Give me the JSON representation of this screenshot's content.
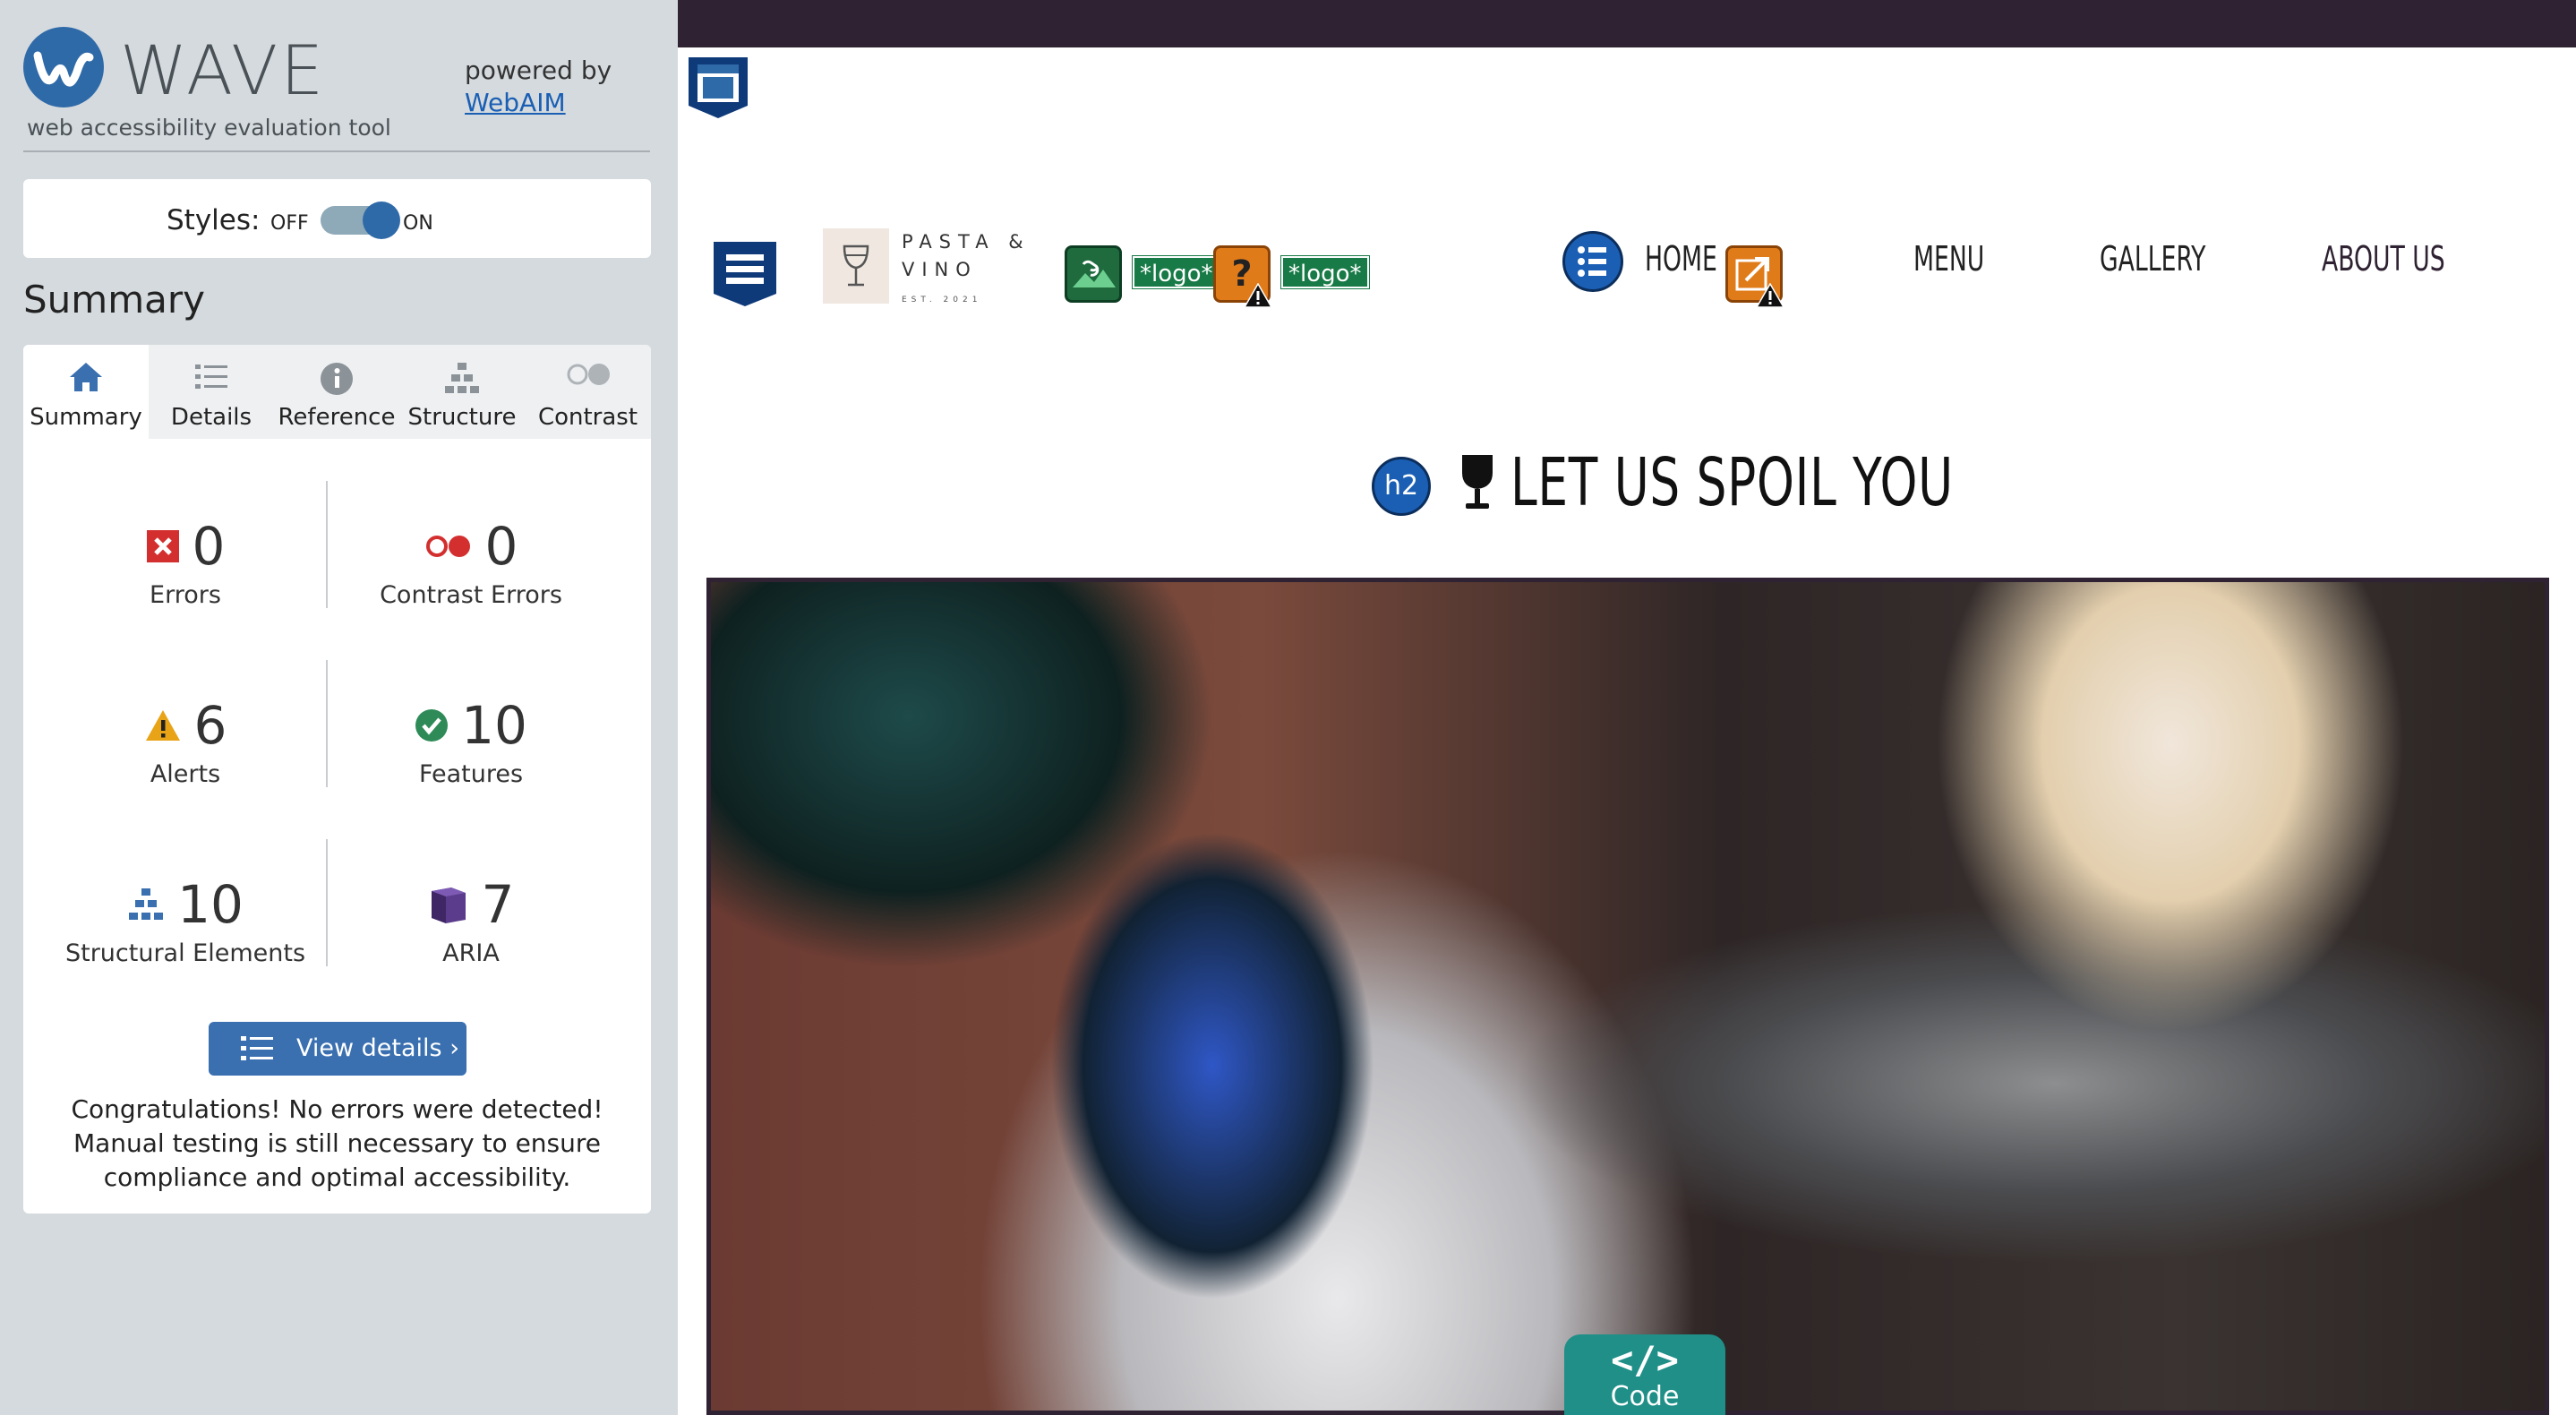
{
  "wave": {
    "title": "WAVE",
    "subtitle": "web accessibility evaluation tool",
    "powered_by": "powered by",
    "webaim_link": "WebAIM",
    "styles": {
      "label": "Styles:",
      "off": "OFF",
      "on": "ON",
      "state": "on"
    },
    "summary_heading": "Summary",
    "tabs": [
      {
        "label": "Summary",
        "icon": "home-icon",
        "active": true
      },
      {
        "label": "Details",
        "icon": "list-icon",
        "active": false
      },
      {
        "label": "Reference",
        "icon": "info-icon",
        "active": false
      },
      {
        "label": "Structure",
        "icon": "hierarchy-icon",
        "active": false
      },
      {
        "label": "Contrast",
        "icon": "contrast-icon",
        "active": false
      }
    ],
    "stats": {
      "errors": {
        "count": "0",
        "label": "Errors",
        "color": "#d32f2f"
      },
      "contrast_errors": {
        "count": "0",
        "label": "Contrast Errors",
        "color": "#d32f2f"
      },
      "alerts": {
        "count": "6",
        "label": "Alerts",
        "color": "#e8a317"
      },
      "features": {
        "count": "10",
        "label": "Features",
        "color": "#2e8b57"
      },
      "structural": {
        "count": "10",
        "label": "Structural Elements",
        "color": "#3a6fb0"
      },
      "aria": {
        "count": "7",
        "label": "ARIA",
        "color": "#5b3c8c"
      }
    },
    "view_details": "View details ›",
    "congrats": "Congratulations! No errors were detected! Manual testing is still necessary to ensure compliance and optimal accessibility."
  },
  "site": {
    "logo_line1": "PASTA &",
    "logo_line2": "VINO",
    "logo_est": "EST. 2021",
    "alt_tag_1": "*logo*",
    "alt_tag_2": "*logo*",
    "nav": [
      "HOME",
      "MENU",
      "GALLERY",
      "ABOUT US"
    ],
    "heading_badge": "h2",
    "heading": "LET US SPOIL YOU",
    "code_tab": {
      "glyph": "</>",
      "label": "Code"
    },
    "colors": {
      "topbar": "#2f2232",
      "nav_about": "#2f2232",
      "accent": "#1f8f88"
    }
  }
}
